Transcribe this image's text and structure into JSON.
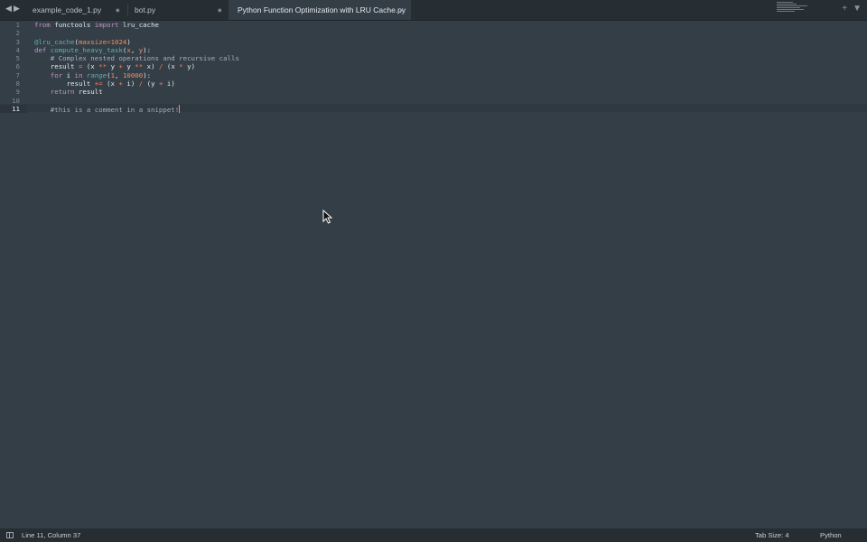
{
  "tabs": [
    {
      "label": "example_code_1.py",
      "active": false
    },
    {
      "label": "bot.py",
      "active": false
    },
    {
      "label": "Python Function Optimization with LRU Cache.py",
      "active": true
    }
  ],
  "tab_close_glyph": "×",
  "tab_unsaved_glyph": "●",
  "line_numbers": [
    "1",
    "2",
    "3",
    "4",
    "5",
    "6",
    "7",
    "8",
    "9",
    "10",
    "11"
  ],
  "current_line": 11,
  "code_tokens": {
    "l1_from": "from",
    "l1_mod": " functools ",
    "l1_import": "import",
    "l1_name": " lru_cache",
    "l3_dec": "@lru_cache",
    "l3_open": "(",
    "l3_arg": "maxsize",
    "l3_eq": "=",
    "l3_num": "1024",
    "l3_close": ")",
    "l4_def": "def",
    "l4_fn": " compute_heavy_task",
    "l4_open": "(",
    "l4_x": "x",
    "l4_comma": ", ",
    "l4_y": "y",
    "l4_close": "):",
    "l5_comment": "    # Complex nested operations and recursive calls",
    "l6_a": "    result ",
    "l6_eq": "=",
    "l6_b": " (x ",
    "l6_p1": "**",
    "l6_c": " y ",
    "l6_plus": "+",
    "l6_d": " y ",
    "l6_p2": "**",
    "l6_e": " x) ",
    "l6_div": "/",
    "l6_f": " (x ",
    "l6_mul": "*",
    "l6_g": " y)",
    "l7_for": "    for",
    "l7_a": " i ",
    "l7_in": "in",
    "l7_sp": " ",
    "l7_range": "range",
    "l7_open": "(",
    "l7_n1": "1",
    "l7_comma": ", ",
    "l7_n2": "10000",
    "l7_close": "):",
    "l8_a": "        result ",
    "l8_op": "+=",
    "l8_b": " (x ",
    "l8_plus1": "+",
    "l8_c": " i) ",
    "l8_div": "/",
    "l8_d": " (y ",
    "l8_plus2": "+",
    "l8_e": " i)",
    "l9_ret": "    return",
    "l9_a": " result",
    "l11_comment": "    #this is a comment in a snippet!"
  },
  "status": {
    "position": "Line 11, Column 37",
    "tab_size": "Tab Size: 4",
    "syntax": "Python"
  },
  "colors": {
    "editor_bg": "#333e47",
    "tabbar_bg": "#262d33",
    "keyword": "#c594c5",
    "function": "#5fb3b3",
    "number": "#f99157",
    "operator": "#f97b58"
  }
}
